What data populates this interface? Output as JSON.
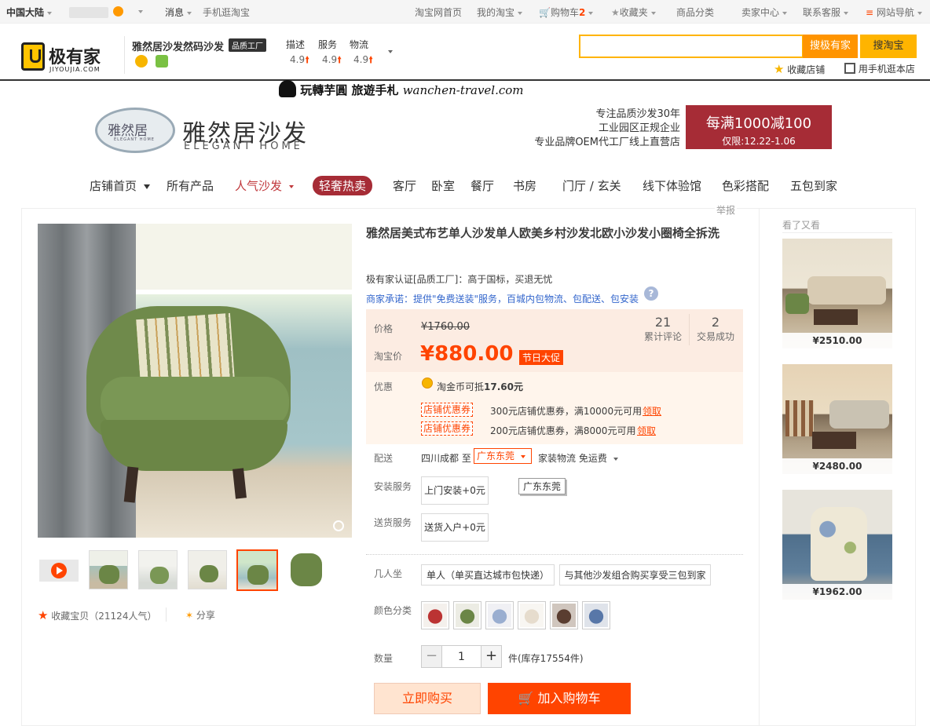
{
  "topbar": {
    "region": "中国大陆",
    "messages": "消息",
    "mobile": "手机逛淘宝",
    "home": "淘宝网首页",
    "my_taobao": "我的淘宝",
    "cart": "购物车",
    "cart_count": "2",
    "favorites": "收藏夹",
    "categories": "商品分类",
    "seller_center": "卖家中心",
    "service": "联系客服",
    "site_nav": "网站导航"
  },
  "shop_header": {
    "logo_text": "极有家",
    "logo_sub": "JIYOUJIA.COM",
    "shop_name": "雅然居沙发然码沙发",
    "shop_badge": "品质工厂",
    "ratings": [
      {
        "label": "描述",
        "value": "4.9"
      },
      {
        "label": "服务",
        "value": "4.9"
      },
      {
        "label": "物流",
        "value": "4.9"
      }
    ],
    "search_jiyou": "搜极有家",
    "search_taobao": "搜淘宝",
    "fav_shop": "收藏店铺",
    "mobile_shop": "用手机逛本店"
  },
  "banner": {
    "watermark": "玩轉芋圓 旅遊手札",
    "watermark_url": "wanchen-travel.com",
    "brand_oval": "雅然居",
    "brand_oval_sub": "ELEGANT HOME",
    "brand_cn": "雅然居沙发",
    "brand_en": "ELEGANT HOME",
    "slogan_1": "专注品质沙发30年",
    "slogan_2": "工业园区正规企业",
    "slogan_3": "专业品牌OEM代工厂线上直营店",
    "promo_title": "每满1000减100",
    "promo_date": "仅限:12.22-1.06"
  },
  "nav": {
    "items": [
      "店铺首页",
      "所有产品",
      "人气沙发",
      "轻奢热卖",
      "客厅",
      "卧室",
      "餐厅",
      "书房",
      "门厅 / 玄关",
      "线下体验馆",
      "色彩搭配",
      "五包到家"
    ]
  },
  "product": {
    "report": "举报",
    "title": "雅然居美式布艺单人沙发单人欧美乡村沙发北欧小沙发小圈椅全拆洗",
    "cert": "极有家认证[品质工厂]：高于国标，买退无忧",
    "promise": "商家承诺：提供\"免费送装\"服务，百城内包物流、包配送、包安装",
    "price_label": "价格",
    "original_price": "¥1760.00",
    "taobao_price_label": "淘宝价",
    "price": "¥880.00",
    "price_tag": "节日大促",
    "reviews_count": "21",
    "reviews_label": "累计评论",
    "sales_count": "2",
    "sales_label": "交易成功",
    "discount_label": "优惠",
    "coins": "淘金币可抵",
    "coins_value": "17.60元",
    "coupons": [
      {
        "tag": "店铺优惠券",
        "text": "300元店铺优惠券，满10000元可用",
        "action": "领取"
      },
      {
        "tag": "店铺优惠券",
        "text": "200元店铺优惠券，满8000元可用",
        "action": "领取"
      }
    ],
    "delivery_label": "配送",
    "delivery_from": "四川成都 至",
    "delivery_to": "广东东莞",
    "delivery_method": "家装物流 免运费",
    "tooltip": "广东东莞",
    "install_label": "安装服务",
    "install_option": "上门安装+0元",
    "send_label": "送货服务",
    "send_option": "送货入户+0元",
    "seats_label": "几人坐",
    "seat_options": [
      "单人（单买直达城市包快递）",
      "与其他沙发组合购买享受三包到家"
    ],
    "color_label": "颜色分类",
    "qty_label": "数量",
    "qty_value": "1",
    "stock": "件(库存17554件)",
    "buy_now": "立即购买",
    "add_cart": "加入购物车",
    "favorite": "收藏宝贝（21124人气）",
    "share": "分享"
  },
  "sidebar": {
    "title": "看了又看",
    "items": [
      {
        "price": "¥2510.00"
      },
      {
        "price": "¥2480.00"
      },
      {
        "price": "¥1962.00"
      }
    ]
  }
}
